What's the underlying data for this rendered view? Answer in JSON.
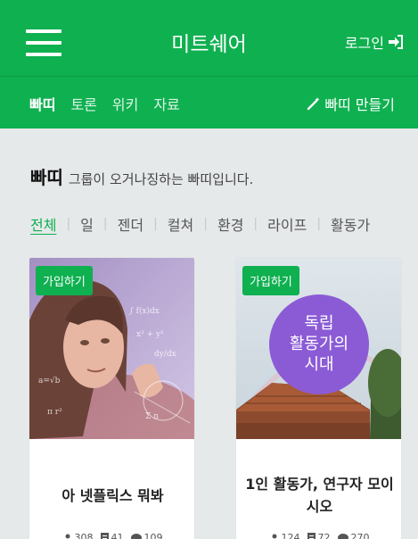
{
  "header": {
    "title": "미트쉐어",
    "login_label": "로그인"
  },
  "subnav": {
    "tabs": [
      {
        "label": "빠띠",
        "active": true
      },
      {
        "label": "토론",
        "active": false
      },
      {
        "label": "위키",
        "active": false
      },
      {
        "label": "자료",
        "active": false
      }
    ],
    "make_label": "빠띠 만들기"
  },
  "intro": {
    "strong": "빠띠",
    "text": "그룹이 오거나징하는 빠띠입니다."
  },
  "filters": [
    "전체",
    "일",
    "젠더",
    "컬쳐",
    "환경",
    "라이프",
    "활동가"
  ],
  "cards": [
    {
      "join_label": "가입하기",
      "title": "아 넷플릭스 뭐봐",
      "members": "308",
      "posts": "41",
      "comments": "109"
    },
    {
      "join_label": "가입하기",
      "title": "1인 활동가, 연구자 모이시오",
      "thumb_text": [
        "독립",
        "활동가의",
        "시대"
      ],
      "members": "124",
      "posts": "72",
      "comments": "270"
    }
  ],
  "colors": {
    "brand": "#0fb050",
    "background": "#e6e9ea",
    "badge_purple": "#8b5bd6"
  },
  "icons": [
    "menu-icon",
    "sign-in-icon",
    "magic-wand-icon",
    "user-icon",
    "document-icon",
    "comment-icon"
  ]
}
